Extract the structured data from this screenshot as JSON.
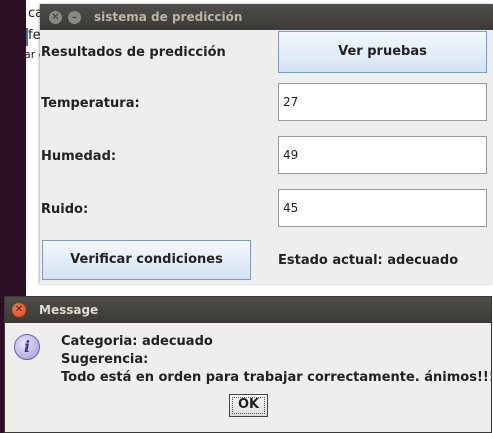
{
  "background": {
    "lines": [
      "ca",
      "fe",
      "ar e"
    ]
  },
  "main_window": {
    "title": "sistema de predicción",
    "results_label": "Resultados de predicción",
    "view_tests_button": "Ver pruebas",
    "fields": {
      "temperatura": {
        "label": "Temperatura:",
        "value": "27"
      },
      "humedad": {
        "label": "Humedad:",
        "value": "49"
      },
      "ruido": {
        "label": "Ruido:",
        "value": "45"
      }
    },
    "verify_button": "Verificar condiciones",
    "status_text": "Estado actual: adecuado"
  },
  "dialog": {
    "title": "Message",
    "category_line": "Categoria: adecuado",
    "suggestion_label": "Sugerencia:",
    "suggestion_text": "Todo está en orden para trabajar correctamente. ánimos!!!",
    "ok_button": "OK",
    "icon": "info-icon"
  }
}
